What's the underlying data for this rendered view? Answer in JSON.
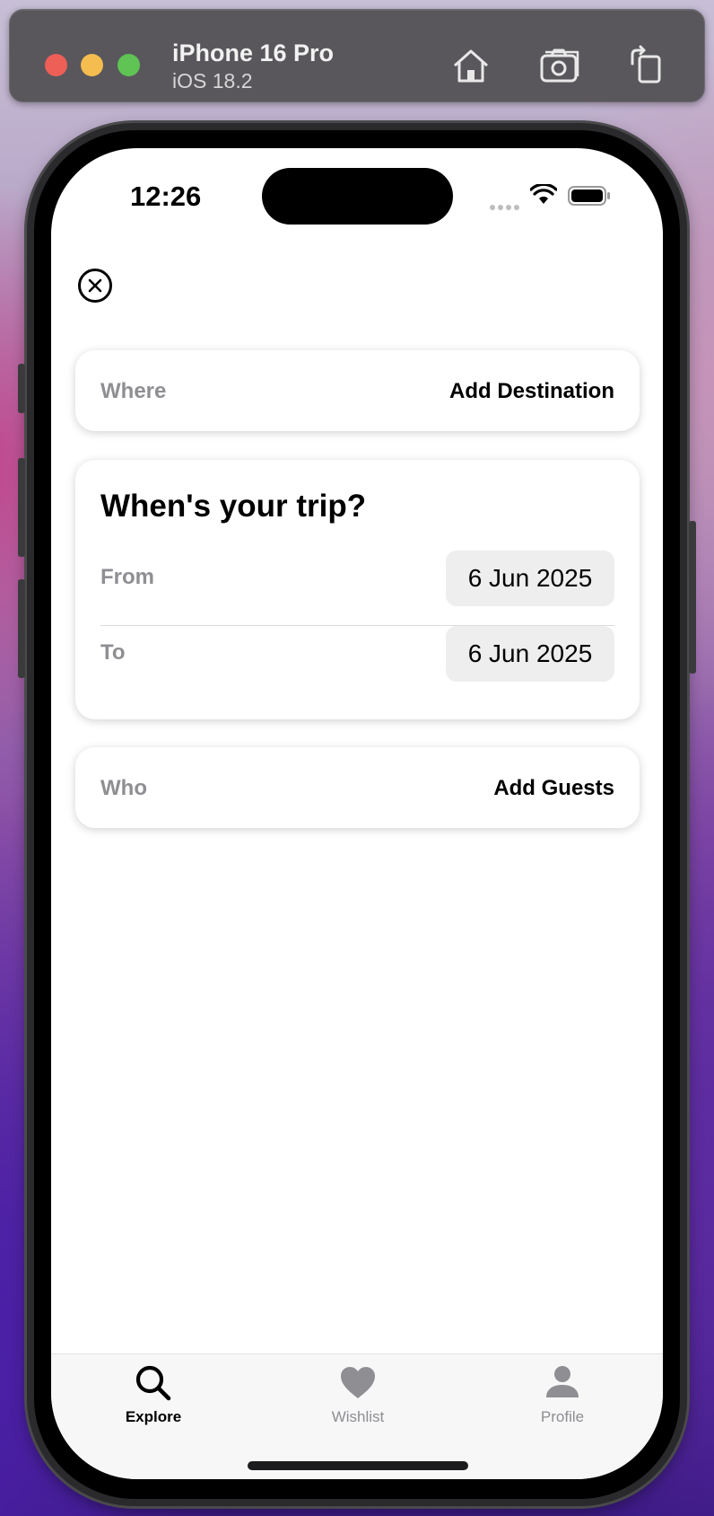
{
  "simulator": {
    "device_name": "iPhone 16 Pro",
    "os_version": "iOS 18.2",
    "icons": [
      "home-icon",
      "screenshot-icon",
      "rotate-icon"
    ]
  },
  "status_bar": {
    "time": "12:26",
    "icons": [
      "cellular-signal-icon",
      "wifi-icon",
      "battery-icon"
    ]
  },
  "close_icon": "close-icon",
  "where": {
    "label": "Where",
    "value": "Add Destination"
  },
  "when": {
    "title": "When's your trip?",
    "from_label": "From",
    "from_value": "6 Jun 2025",
    "to_label": "To",
    "to_value": "6 Jun 2025"
  },
  "who": {
    "label": "Who",
    "value": "Add Guests"
  },
  "tabs": [
    {
      "label": "Explore",
      "icon": "search-icon",
      "active": true
    },
    {
      "label": "Wishlist",
      "icon": "heart-icon",
      "active": false
    },
    {
      "label": "Profile",
      "icon": "person-icon",
      "active": false
    }
  ],
  "colors": {
    "active_tab": "#000000",
    "inactive_tab": "#8e8e93",
    "secondary_label": "#8e8e93",
    "date_pill_bg": "#eeeeef"
  }
}
